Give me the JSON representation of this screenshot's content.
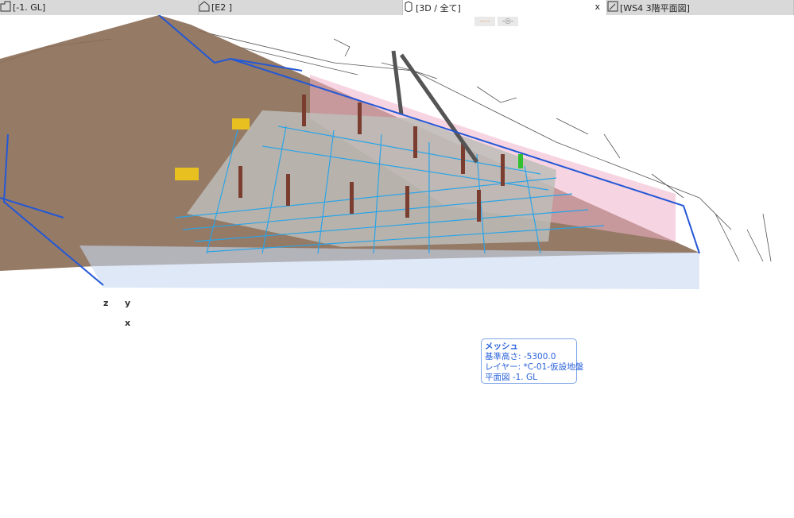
{
  "tabs": [
    {
      "label": "[-1. GL]",
      "icon": "floor-plan-icon"
    },
    {
      "label": "[E2 ]",
      "icon": "elevation-icon"
    },
    {
      "label": "[3D / 全て]",
      "icon": "3d-view-icon",
      "active": true,
      "close": "x"
    },
    {
      "label": "[WS4 3階平面図]",
      "icon": "worksheet-icon"
    }
  ],
  "mini_toolbar": [
    "----",
    "-◎-"
  ],
  "axes": {
    "z": "z",
    "y": "y",
    "x": "x"
  },
  "tooltip": {
    "title": "メッシュ",
    "lines": [
      "基準高さ: -5300.0",
      "レイヤー: *C-01-仮設地盤",
      "平面図 -1. GL"
    ]
  },
  "colors": {
    "ground": "#8a6b55",
    "outline": "#2458d6",
    "grid": "#2aa4e8",
    "pink": "#f0b0c8",
    "tooltip": "#2a62d9"
  }
}
